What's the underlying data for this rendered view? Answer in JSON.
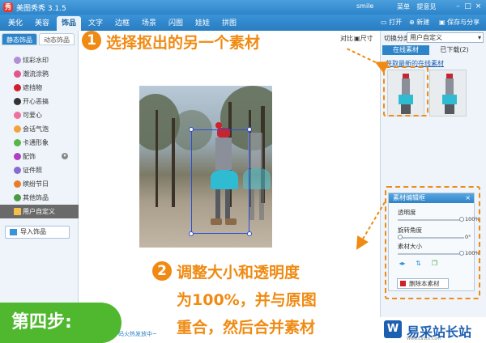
{
  "app": {
    "title": "美图秀秀 3.1.5",
    "logo_glyph": "秀",
    "user": "smile",
    "links": [
      "菜单",
      "提意见"
    ]
  },
  "nav": {
    "tabs": [
      "美化",
      "美容",
      "饰品",
      "文字",
      "边框",
      "场景",
      "闪图",
      "娃娃",
      "拼图"
    ],
    "active": "饰品",
    "tools": {
      "open": "打开",
      "new": "新建",
      "save_share": "保存与分享"
    }
  },
  "left_panel": {
    "subtabs": [
      "静态饰品",
      "动态饰品"
    ],
    "categories": [
      "炫彩水印",
      "潮流涂鸦",
      "遮挡物",
      "开心恶搞",
      "可爱心",
      "会话气泡",
      "卡通形象",
      "配饰",
      "证件照",
      "缤纷节日",
      "其他饰品",
      "用户自定义"
    ],
    "active_category": "用户自定义",
    "import_button": "导入饰品"
  },
  "canvas": {
    "top_labels": [
      "对比",
      "尺寸"
    ]
  },
  "right_panel": {
    "switch_label": "切换分类",
    "category_select": "用户自定义",
    "tabs": [
      "在线素材",
      "已下载(2)"
    ],
    "link": "获取最新的在线素材"
  },
  "edit_box": {
    "title": "素材编辑框",
    "close": "×",
    "sliders": [
      {
        "label": "透明度",
        "value": "100%",
        "level": 1.0
      },
      {
        "label": "旋转角度",
        "value": "0°",
        "level": 0.0
      },
      {
        "label": "素材大小",
        "value": "100%",
        "level": 1.0
      }
    ],
    "delete_button": "删除本素材"
  },
  "annotations": {
    "step1_number": "1",
    "step1_text": "选择抠出的另一个素材",
    "step2_number": "2",
    "step2_line1": "调整大小和透明度",
    "step2_line2": "为100%，并与原图",
    "step2_line3": "重合，然后合并素材"
  },
  "step_badge": "第四步:",
  "ticker": "码火热发放中~",
  "watermark": {
    "logo_glyph": "W",
    "name": "易采站长站",
    "url": "Www.EaSck.Com"
  },
  "colors": {
    "accent_orange": "#f08a12",
    "app_blue": "#2d84c9",
    "step_green": "#4fb82e",
    "selection_blue": "#2b4fd8"
  }
}
